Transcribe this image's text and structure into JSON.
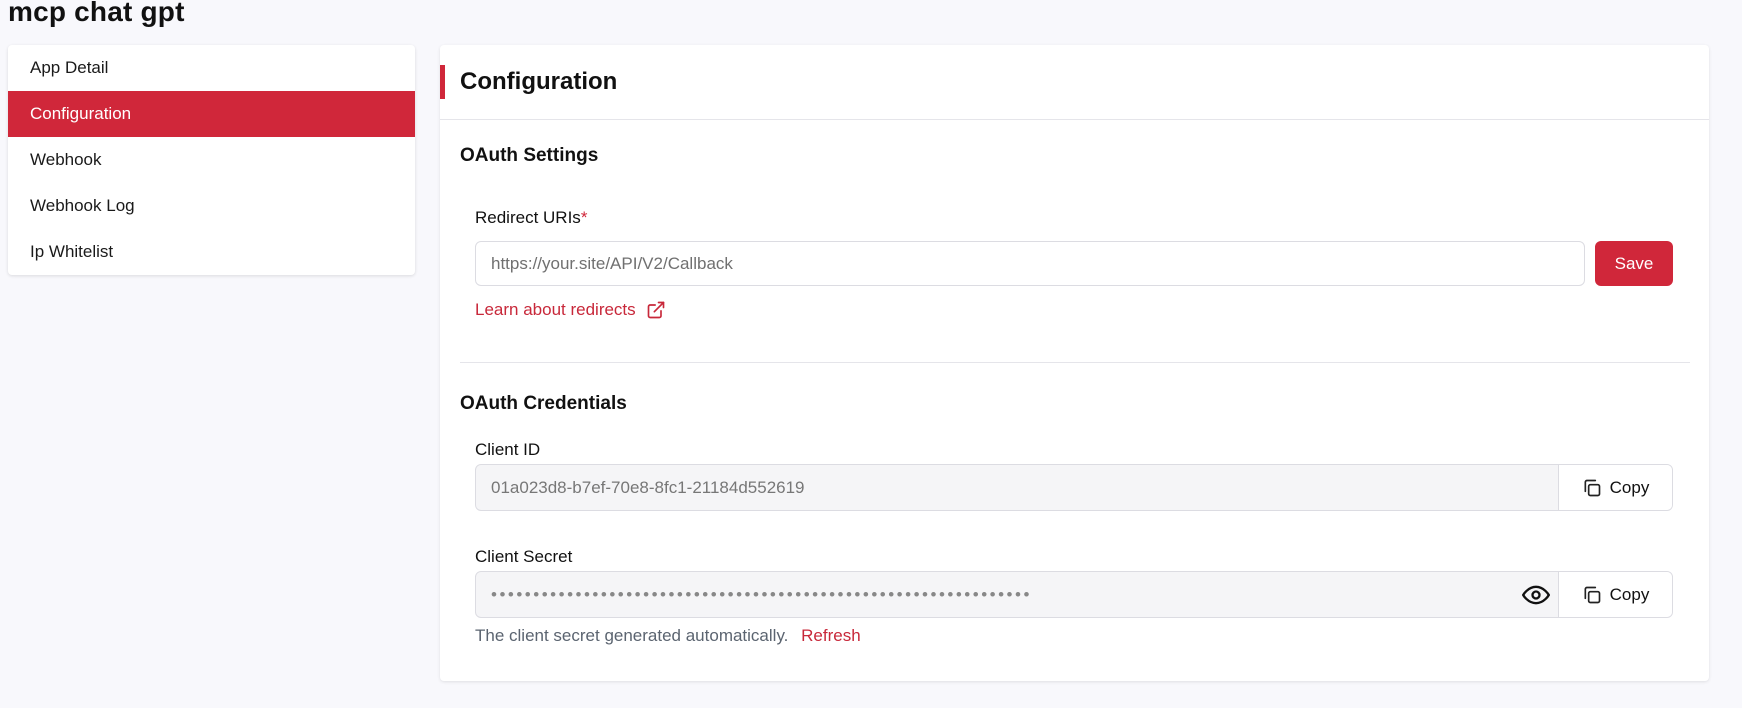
{
  "app": {
    "title": "mcp chat gpt"
  },
  "sidebar": {
    "items": [
      {
        "label": "App Detail",
        "active": false
      },
      {
        "label": "Configuration",
        "active": true
      },
      {
        "label": "Webhook",
        "active": false
      },
      {
        "label": "Webhook Log",
        "active": false
      },
      {
        "label": "Ip Whitelist",
        "active": false
      }
    ]
  },
  "main": {
    "title": "Configuration",
    "oauth_settings": {
      "title": "OAuth Settings",
      "redirect_label": "Redirect URIs",
      "required_mark": "*",
      "redirect_placeholder": "https://your.site/API/V2/Callback",
      "redirect_value": "",
      "save_label": "Save",
      "learn_link": "Learn about redirects"
    },
    "oauth_credentials": {
      "title": "OAuth Credentials",
      "client_id_label": "Client ID",
      "client_id_value": "01a023d8-b7ef-70e8-8fc1-21184d552619",
      "copy_label": "Copy",
      "client_secret_label": "Client Secret",
      "client_secret_masked": "••••••••••••••••••••••••••••••••••••••••••••••••••••••••••••••••",
      "helper_text": "The client secret generated automatically.",
      "refresh_label": "Refresh"
    }
  },
  "colors": {
    "accent": "#d0273a",
    "background": "#f8f8fc",
    "card": "#ffffff"
  },
  "icons": {
    "external_link": "external-link-icon",
    "copy": "copy-icon",
    "eye": "eye-icon"
  }
}
